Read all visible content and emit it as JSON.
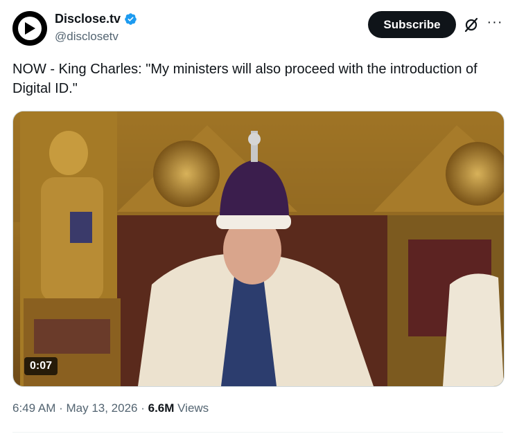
{
  "author": {
    "display_name": "Disclose.tv",
    "handle": "@disclosetv",
    "verified_icon": "verified-badge-icon",
    "avatar_icon": "play-logo-icon"
  },
  "actions": {
    "subscribe_label": "Subscribe",
    "grok_icon": "grok-icon",
    "more_icon": "more-options-icon"
  },
  "tweet": {
    "text": "NOW - King Charles: \"My ministers will also proceed with the introduction of Digital ID.\""
  },
  "media": {
    "type": "video",
    "duration": "0:07"
  },
  "meta": {
    "time": "6:49 AM",
    "separator1": " · ",
    "date": "May 13, 2026",
    "separator2": " · ",
    "views_count": "6.6M",
    "views_label": " Views"
  },
  "colors": {
    "accent": "#1d9bf0",
    "text_primary": "#0f1419",
    "text_secondary": "#536471",
    "button_bg": "#0f1419"
  }
}
